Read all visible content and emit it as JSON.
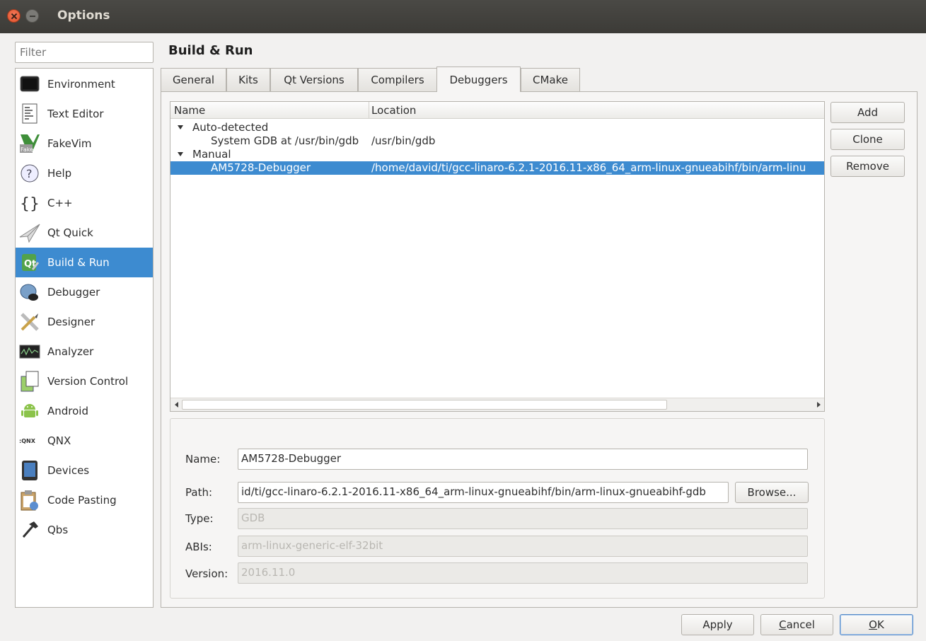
{
  "window": {
    "title": "Options"
  },
  "filter": {
    "placeholder": "Filter"
  },
  "sidebar": {
    "items": [
      {
        "label": "Environment",
        "icon": "monitor-icon"
      },
      {
        "label": "Text Editor",
        "icon": "text-document-icon"
      },
      {
        "label": "FakeVim",
        "icon": "fakevim-icon"
      },
      {
        "label": "Help",
        "icon": "help-icon"
      },
      {
        "label": "C++",
        "icon": "braces-icon"
      },
      {
        "label": "Qt Quick",
        "icon": "paper-plane-icon"
      },
      {
        "label": "Build & Run",
        "icon": "qt-build-icon",
        "selected": true
      },
      {
        "label": "Debugger",
        "icon": "debugger-icon"
      },
      {
        "label": "Designer",
        "icon": "designer-icon"
      },
      {
        "label": "Analyzer",
        "icon": "analyzer-icon"
      },
      {
        "label": "Version Control",
        "icon": "version-control-icon"
      },
      {
        "label": "Android",
        "icon": "android-icon"
      },
      {
        "label": "QNX",
        "icon": "qnx-icon"
      },
      {
        "label": "Devices",
        "icon": "tablet-icon"
      },
      {
        "label": "Code Pasting",
        "icon": "clipboard-icon"
      },
      {
        "label": "Qbs",
        "icon": "hammer-icon"
      }
    ]
  },
  "page": {
    "title": "Build & Run"
  },
  "tabs": [
    {
      "label": "General"
    },
    {
      "label": "Kits"
    },
    {
      "label": "Qt Versions"
    },
    {
      "label": "Compilers"
    },
    {
      "label": "Debuggers",
      "active": true
    },
    {
      "label": "CMake"
    }
  ],
  "tree": {
    "columns": [
      "Name",
      "Location"
    ],
    "groups": [
      {
        "label": "Auto-detected",
        "rows": [
          {
            "name": "System GDB at /usr/bin/gdb",
            "location": "/usr/bin/gdb"
          }
        ]
      },
      {
        "label": "Manual",
        "rows": [
          {
            "name": "AM5728-Debugger",
            "location": "/home/david/ti/gcc-linaro-6.2.1-2016.11-x86_64_arm-linux-gnueabihf/bin/arm-linu",
            "selected": true
          }
        ]
      }
    ]
  },
  "side_buttons": {
    "add": "Add",
    "clone": "Clone",
    "remove": "Remove"
  },
  "details": {
    "name_label": "Name:",
    "name_value": "AM5728-Debugger",
    "path_label": "Path:",
    "path_value": "id/ti/gcc-linaro-6.2.1-2016.11-x86_64_arm-linux-gnueabihf/bin/arm-linux-gnueabihf-gdb",
    "browse": "Browse...",
    "type_label": "Type:",
    "type_value": "GDB",
    "abis_label": "ABIs:",
    "abis_value": "arm-linux-generic-elf-32bit",
    "version_label": "Version:",
    "version_value": "2016.11.0"
  },
  "footer": {
    "apply": "Apply",
    "cancel_u": "C",
    "cancel_rest": "ancel",
    "ok_u": "O",
    "ok_rest": "K"
  },
  "colors": {
    "selection": "#3d8bd0",
    "titlebar": "#3c3b37",
    "window_bg": "#f2f1f0"
  }
}
